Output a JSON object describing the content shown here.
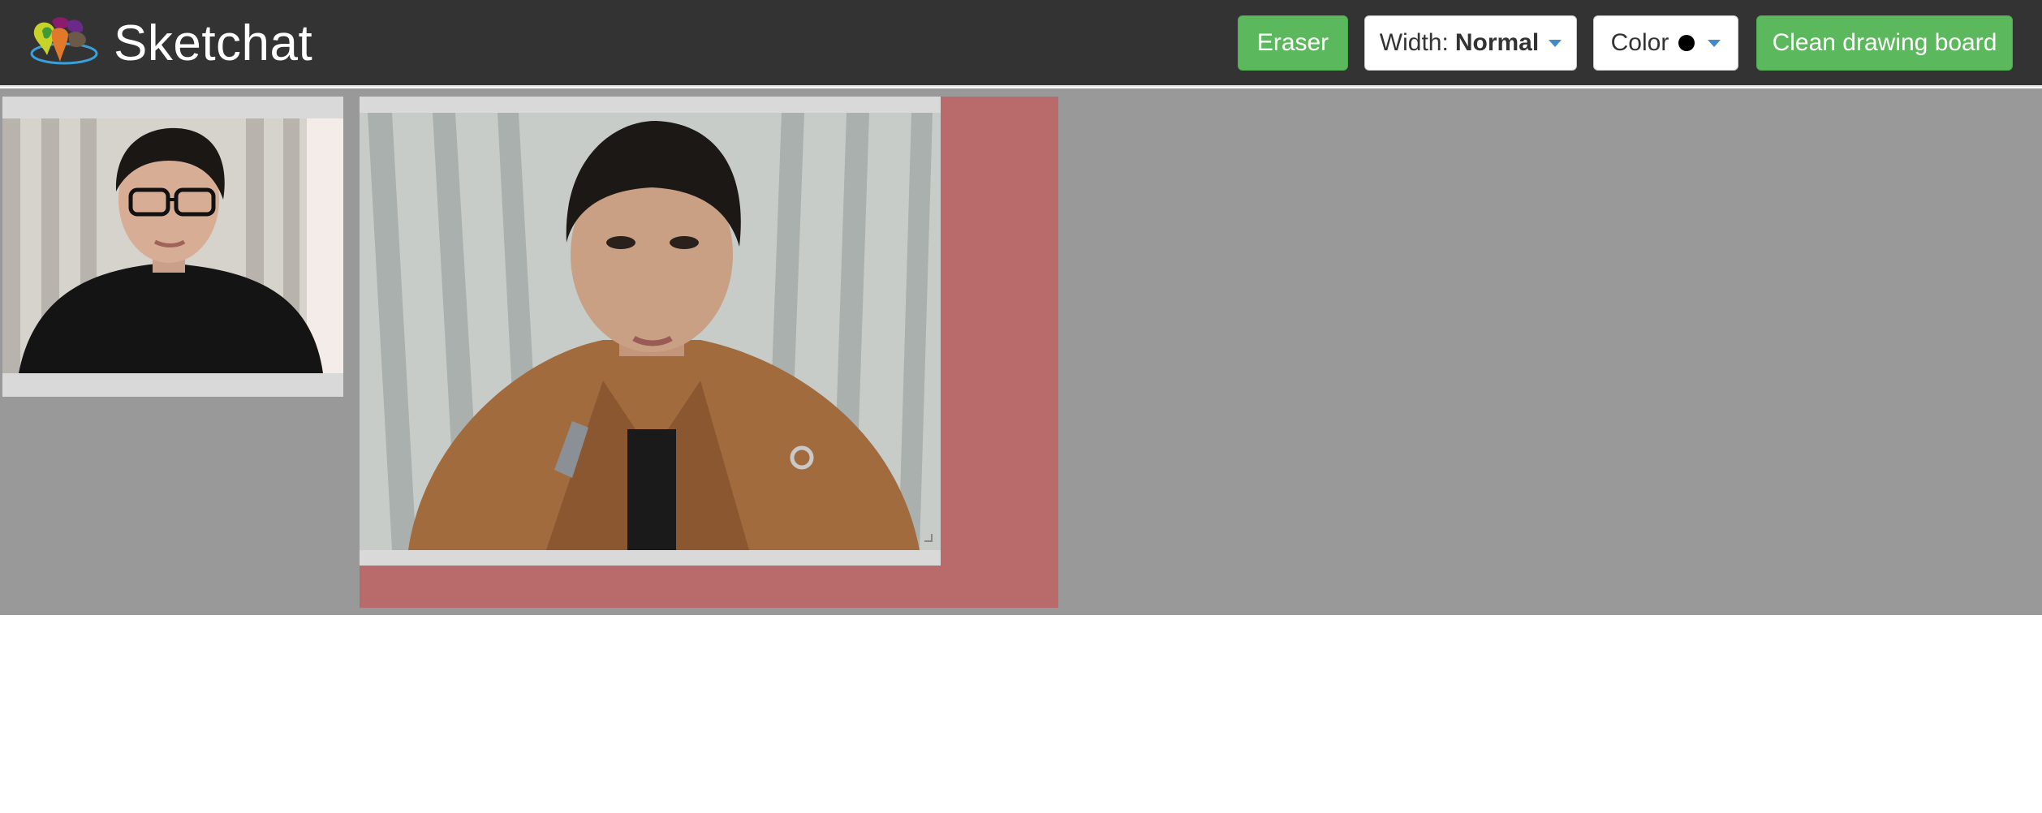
{
  "app": {
    "title": "Sketchat",
    "logo_icon": "paint-splash-logo-icon"
  },
  "toolbar": {
    "eraser_label": "Eraser",
    "width_label": "Width:",
    "width_value": "Normal",
    "color_label": "Color",
    "color_value": "#000000",
    "clean_label": "Clean drawing board"
  },
  "colors": {
    "navbar": "#333333",
    "green": "#5cb85c",
    "stage": "#999999",
    "board": "#b96b6b",
    "frame": "#d9d9d9"
  },
  "videos": {
    "local": {
      "icon": "webcam-video-person-glasses"
    },
    "remote": {
      "icon": "webcam-video-person-coat"
    }
  }
}
